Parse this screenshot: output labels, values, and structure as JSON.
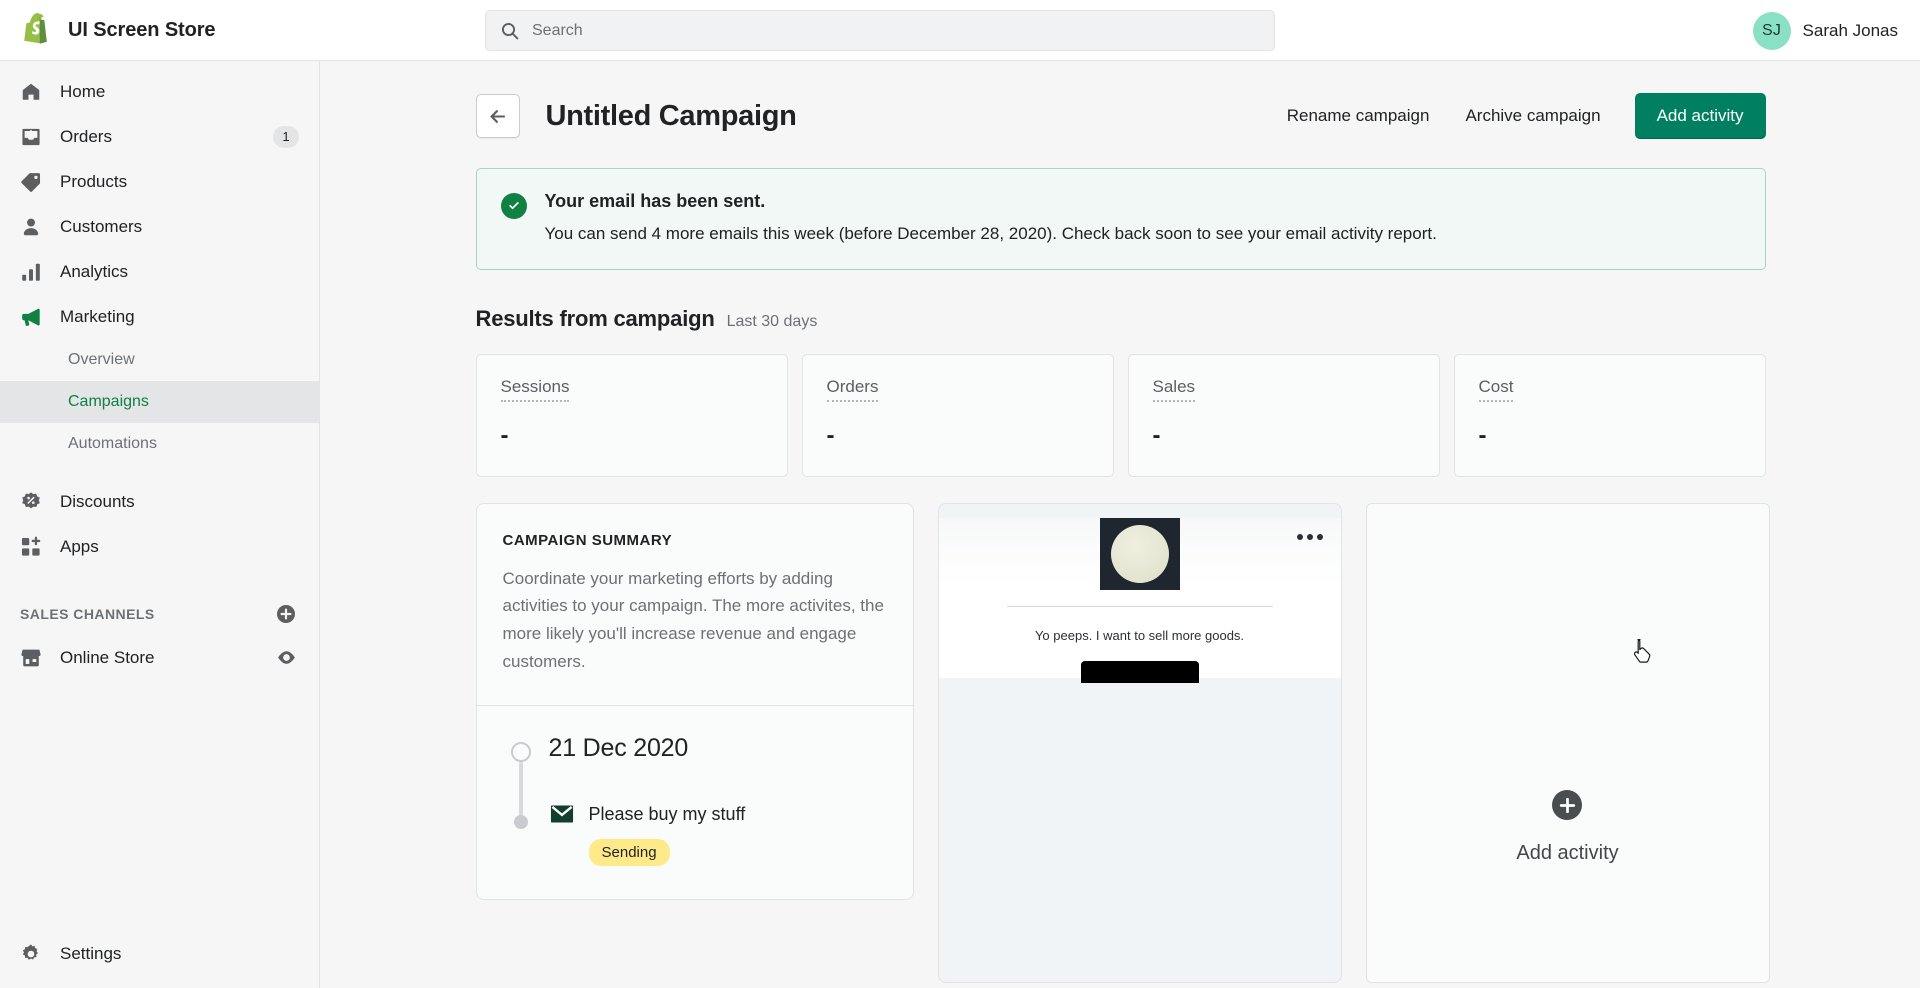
{
  "topbar": {
    "brand_name": "UI Screen Store",
    "logo_icon": "shopify-bag-logo",
    "search": {
      "placeholder": "Search",
      "value": "",
      "icon": "search-icon"
    },
    "user": {
      "initials": "SJ",
      "name": "Sarah Jonas"
    }
  },
  "sidebar": {
    "items": [
      {
        "label": "Home",
        "icon": "home-icon",
        "badge": ""
      },
      {
        "label": "Orders",
        "icon": "orders-inbox-icon",
        "badge": "1"
      },
      {
        "label": "Products",
        "icon": "tag-icon",
        "badge": ""
      },
      {
        "label": "Customers",
        "icon": "person-icon",
        "badge": ""
      },
      {
        "label": "Analytics",
        "icon": "bar-chart-icon",
        "badge": ""
      },
      {
        "label": "Marketing",
        "icon": "megaphone-icon",
        "badge": ""
      }
    ],
    "marketing_subitems": [
      {
        "label": "Overview",
        "active": false
      },
      {
        "label": "Campaigns",
        "active": true
      },
      {
        "label": "Automations",
        "active": false
      }
    ],
    "items_after": [
      {
        "label": "Discounts",
        "icon": "discount-badge-icon"
      },
      {
        "label": "Apps",
        "icon": "apps-grid-plus-icon"
      }
    ],
    "sales_channels": {
      "title": "SALES CHANNELS",
      "add_icon": "plus-circle-icon",
      "items": [
        {
          "label": "Online Store",
          "icon": "storefront-icon",
          "trailing_icon": "eye-icon"
        }
      ]
    },
    "settings": {
      "label": "Settings",
      "icon": "gear-icon"
    },
    "active_color": "#108043"
  },
  "page": {
    "back_icon": "arrow-left-icon",
    "title": "Untitled Campaign",
    "actions": {
      "rename": "Rename campaign",
      "archive": "Archive campaign",
      "add_activity": "Add activity"
    },
    "primary_color": "#008060"
  },
  "banner": {
    "icon": "check-circle-icon",
    "title": "Your email has been sent.",
    "text": "You can send 4 more emails this week (before December 28, 2020). Check back soon to see your email activity report.",
    "bg_color": "#f1f8f5",
    "border_color": "#a6d5bf",
    "icon_color": "#108043"
  },
  "results": {
    "heading": "Results from campaign",
    "subheading": "Last 30 days",
    "metrics": [
      {
        "label": "Sessions",
        "value": "-"
      },
      {
        "label": "Orders",
        "value": "-"
      },
      {
        "label": "Sales",
        "value": "-"
      },
      {
        "label": "Cost",
        "value": "-"
      }
    ]
  },
  "summary_card": {
    "kicker": "CAMPAIGN SUMMARY",
    "body": "Coordinate your marketing efforts by adding activities to your campaign. The more activites, the more likely you'll increase revenue and engage customers.",
    "timeline": {
      "date": "21 Dec 2020",
      "activity_icon": "email-icon",
      "activity_name": "Please buy my stuff",
      "status": "Sending",
      "status_bg": "#ffea8a"
    }
  },
  "preview_card": {
    "menu_icon": "more-horizontal-icon",
    "hero_image_alt": "moon-image",
    "caption": "Yo peeps. I want to sell more goods.",
    "cta_alt": "black-button"
  },
  "add_card": {
    "plus_icon": "plus-icon",
    "label": "Add activity"
  },
  "cursor": {
    "type": "pointer-hand-cursor"
  }
}
